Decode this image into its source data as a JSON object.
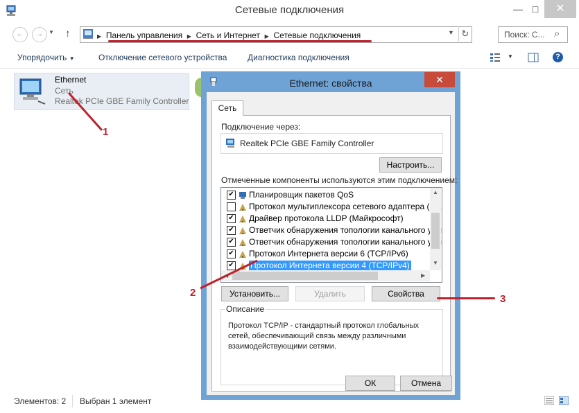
{
  "window": {
    "title": "Сетевые подключения",
    "minimize": "—",
    "maximize": "□",
    "close": "✕"
  },
  "nav": {
    "back": "←",
    "forward": "→",
    "up": "↑",
    "breadcrumbs": [
      "Панель управления",
      "Сеть и Интернет",
      "Сетевые подключения"
    ],
    "search_placeholder": "Поиск: С...",
    "search_glyph": "⌕"
  },
  "toolbar": {
    "organize": "Упорядочить",
    "disable": "Отключение сетевого устройства",
    "diagnose": "Диагностика подключения"
  },
  "connection": {
    "name": "Ethernet",
    "network": "Сеть",
    "adapter": "Realtek PCIe GBE Family Controller"
  },
  "status": {
    "items": "Элементов: 2",
    "selected": "Выбран 1 элемент"
  },
  "dialog": {
    "title": "Ethernet: свойства",
    "close": "✕",
    "tab": "Сеть",
    "connect_via_label": "Подключение через:",
    "adapter": "Realtek PCIe GBE Family Controller",
    "configure": "Настроить...",
    "components_label": "Отмеченные компоненты используются этим подключением:",
    "components": [
      {
        "label": "Планировщик пакетов QoS",
        "checked": true
      },
      {
        "label": "Протокол мультиплексора сетевого адаптера (Майк",
        "checked": false
      },
      {
        "label": "Драйвер протокола LLDP (Майкрософт)",
        "checked": true
      },
      {
        "label": "Ответчик обнаружения топологии канального уров",
        "checked": true
      },
      {
        "label": "Ответчик обнаружения топологии канального уров",
        "checked": true
      },
      {
        "label": "Протокол Интернета версии 6 (TCP/IPv6)",
        "checked": true
      },
      {
        "label": "Протокол Интернета версии 4 (TCP/IPv4)",
        "checked": true,
        "selected": true
      }
    ],
    "install": "Установить...",
    "uninstall": "Удалить",
    "properties": "Свойства",
    "description_label": "Описание",
    "description": "Протокол TCP/IP - стандартный протокол глобальных сетей, обеспечивающий связь между различными взаимодействующими сетями.",
    "ok": "ОК",
    "cancel": "Отмена"
  },
  "annotations": {
    "one": "1",
    "two": "2",
    "three": "3",
    "color": "#c0202c"
  }
}
